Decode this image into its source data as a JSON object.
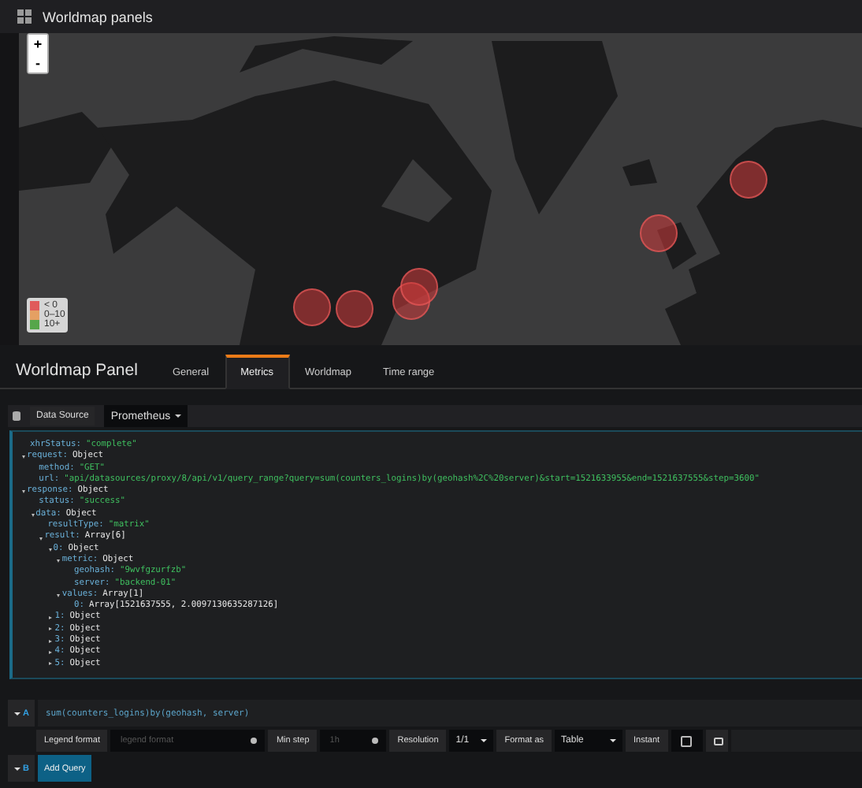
{
  "header": {
    "title": "Worldmap panels"
  },
  "map": {
    "zoom_in": "+",
    "zoom_out": "-",
    "legend": [
      {
        "label": "< 0",
        "color": "#e05b5b"
      },
      {
        "label": "0–10",
        "color": "#e5a063"
      },
      {
        "label": "10+",
        "color": "#56a64b"
      }
    ]
  },
  "panel": {
    "title": "Worldmap Panel",
    "tabs": [
      {
        "label": "General",
        "selected": false
      },
      {
        "label": "Metrics",
        "selected": true
      },
      {
        "label": "Worldmap",
        "selected": false
      },
      {
        "label": "Time range",
        "selected": false
      }
    ]
  },
  "datasource": {
    "label": "Data Source",
    "value": "Prometheus"
  },
  "inspector": [
    {
      "key": "xhrStatus:",
      "value": "\"complete\"",
      "kind": "string"
    },
    {
      "key": "request:",
      "value": "Object",
      "kind": "type",
      "expanded": true,
      "children": [
        {
          "key": "method:",
          "value": "\"GET\"",
          "kind": "string"
        },
        {
          "key": "url:",
          "value": "\"api/datasources/proxy/8/api/v1/query_range?query=sum(counters_logins)by(geohash%2C%20server)&start=1521633955&end=1521637555&step=3600\"",
          "kind": "string"
        }
      ]
    },
    {
      "key": "response:",
      "value": "Object",
      "kind": "type",
      "expanded": true,
      "children": [
        {
          "key": "status:",
          "value": "\"success\"",
          "kind": "string"
        },
        {
          "key": "data:",
          "value": "Object",
          "kind": "type",
          "expanded": true,
          "children": [
            {
              "key": "resultType:",
              "value": "\"matrix\"",
              "kind": "string"
            },
            {
              "key": "result:",
              "value": "Array[6]",
              "kind": "type",
              "expanded": true,
              "children": [
                {
                  "key": "0:",
                  "value": "Object",
                  "kind": "type",
                  "expanded": true,
                  "children": [
                    {
                      "key": "metric:",
                      "value": "Object",
                      "kind": "type",
                      "expanded": true,
                      "children": [
                        {
                          "key": "geohash:",
                          "value": "\"9wvfgzurfzb\"",
                          "kind": "string"
                        },
                        {
                          "key": "server:",
                          "value": "\"backend-01\"",
                          "kind": "string"
                        }
                      ]
                    },
                    {
                      "key": "values:",
                      "value": "Array[1]",
                      "kind": "type",
                      "expanded": true,
                      "children": [
                        {
                          "key": "0:",
                          "value": "Array[1521637555, 2.0097130635287126]",
                          "kind": "type"
                        }
                      ]
                    }
                  ]
                },
                {
                  "key": "1:",
                  "value": "Object",
                  "kind": "type",
                  "expanded": false
                },
                {
                  "key": "2:",
                  "value": "Object",
                  "kind": "type",
                  "expanded": false
                },
                {
                  "key": "3:",
                  "value": "Object",
                  "kind": "type",
                  "expanded": false
                },
                {
                  "key": "4:",
                  "value": "Object",
                  "kind": "type",
                  "expanded": false
                },
                {
                  "key": "5:",
                  "value": "Object",
                  "kind": "type",
                  "expanded": false
                }
              ]
            }
          ]
        }
      ]
    }
  ],
  "queries": [
    {
      "letter": "A",
      "expression": "sum(counters_logins)by(geohash, server)",
      "options": {
        "legend_label": "Legend format",
        "legend_placeholder": "legend format",
        "min_step_label": "Min step",
        "min_step_placeholder": "1h",
        "resolution_label": "Resolution",
        "resolution": "1/1",
        "format_label": "Format as",
        "format": "Table",
        "instant_label": "Instant",
        "instant": false
      }
    },
    {
      "letter": "B"
    }
  ],
  "add_query": "Add Query"
}
